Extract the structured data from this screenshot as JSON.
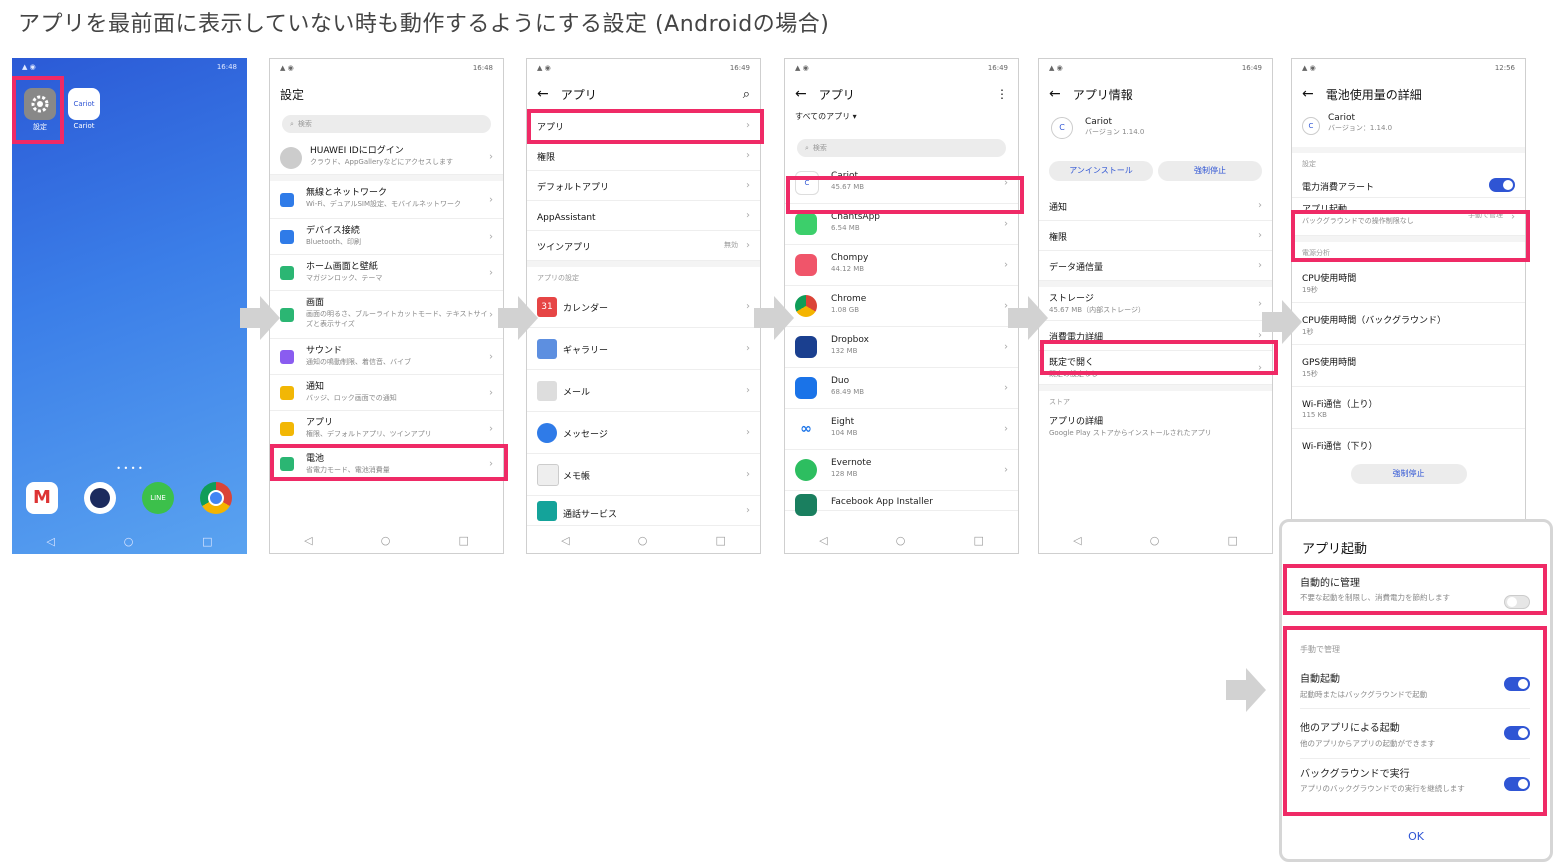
{
  "title": "アプリを最前面に表示していない時も動作するようにする設定 (Androidの場合)",
  "status_times": [
    "16:48",
    "16:48",
    "16:49",
    "16:49",
    "16:49",
    "12:56"
  ],
  "home": {
    "settings_label": "設定",
    "cariot_label": "Cariot",
    "cariot_logo_text": "Cariot",
    "nav": [
      "◁",
      "○",
      "□"
    ]
  },
  "s2": {
    "header": "設定",
    "search": "検索",
    "huawei_title": "HUAWEI IDにログイン",
    "huawei_sub": "クラウド、AppGalleryなどにアクセスします",
    "items": [
      {
        "t": "無線とネットワーク",
        "s": "Wi-Fi、デュアルSIM設定、モバイルネットワーク"
      },
      {
        "t": "デバイス接続",
        "s": "Bluetooth、印刷"
      },
      {
        "t": "ホーム画面と壁紙",
        "s": "マガジンロック、テーマ"
      },
      {
        "t": "画面",
        "s": "画面の明るさ、ブルーライトカットモード、テキストサイズと表示サイズ"
      },
      {
        "t": "サウンド",
        "s": "通知の鳴動制限、着信音、バイブ"
      },
      {
        "t": "通知",
        "s": "バッジ、ロック画面での通知"
      },
      {
        "t": "アプリ",
        "s": "権限、デフォルトアプリ、ツインアプリ"
      },
      {
        "t": "電池",
        "s": "省電力モード、電池消費量"
      }
    ]
  },
  "s3": {
    "header": "アプリ",
    "items": [
      "アプリ",
      "権限",
      "デフォルトアプリ",
      "AppAssistant",
      "ツインアプリ"
    ],
    "twin_value": "無効",
    "section": "アプリの設定",
    "apps": [
      "カレンダー",
      "ギャラリー",
      "メール",
      "メッセージ",
      "メモ帳",
      "通話サービス"
    ],
    "calendar_icon_text": "31"
  },
  "s4": {
    "header": "アプリ",
    "filter": "すべてのアプリ",
    "search": "検索",
    "apps": [
      {
        "name": "Cariot",
        "size": "45.67 MB"
      },
      {
        "name": "ChantsApp",
        "size": "6.54 MB"
      },
      {
        "name": "Chompy",
        "size": "44.12 MB"
      },
      {
        "name": "Chrome",
        "size": "1.08 GB"
      },
      {
        "name": "Dropbox",
        "size": "132 MB"
      },
      {
        "name": "Duo",
        "size": "68.49 MB"
      },
      {
        "name": "Eight",
        "size": "104 MB"
      },
      {
        "name": "Evernote",
        "size": "128 MB"
      },
      {
        "name": "Facebook App Installer",
        "size": ""
      }
    ]
  },
  "s5": {
    "header": "アプリ情報",
    "app_name": "Cariot",
    "version": "バージョン 1.14.0",
    "uninstall": "アンインストール",
    "force_stop": "強制停止",
    "items": [
      "通知",
      "権限",
      "データ通信量"
    ],
    "storage_t": "ストレージ",
    "storage_s": "45.67 MB（内部ストレージ）",
    "power_t": "消費電力詳細",
    "default_t": "既定で開く",
    "default_s": "既定の設定なし",
    "store_section": "ストア",
    "app_detail_t": "アプリの詳細",
    "app_detail_s": "Google Play ストアからインストールされたアプリ"
  },
  "s6": {
    "header": "電池使用量の詳細",
    "app_name": "Cariot",
    "version": "バージョン：1.14.0",
    "section1": "設定",
    "alert": "電力消費アラート",
    "launch_t": "アプリ起動",
    "launch_s": "バックグラウンドでの操作制限なし",
    "launch_value": "手動で管理",
    "section2": "電源分析",
    "metrics": [
      {
        "t": "CPU使用時間",
        "s": "19秒"
      },
      {
        "t": "CPU使用時間（バックグラウンド）",
        "s": "1秒"
      },
      {
        "t": "GPS使用時間",
        "s": "15秒"
      },
      {
        "t": "Wi-Fi通信（上り）",
        "s": "115 KB"
      },
      {
        "t": "Wi-Fi通信（下り）",
        "s": ""
      }
    ],
    "force_stop": "強制停止"
  },
  "dialog": {
    "title": "アプリ起動",
    "auto_t": "自動的に管理",
    "auto_s": "不要な起動を制限し、消費電力を節約します",
    "manual_section": "手動で管理",
    "options": [
      {
        "t": "自動起動",
        "s": "起動時またはバックグラウンドで起動"
      },
      {
        "t": "他のアプリによる起動",
        "s": "他のアプリからアプリの起動ができます"
      },
      {
        "t": "バックグラウンドで実行",
        "s": "アプリのバックグラウンドでの実行を継続します"
      }
    ],
    "ok": "OK"
  }
}
